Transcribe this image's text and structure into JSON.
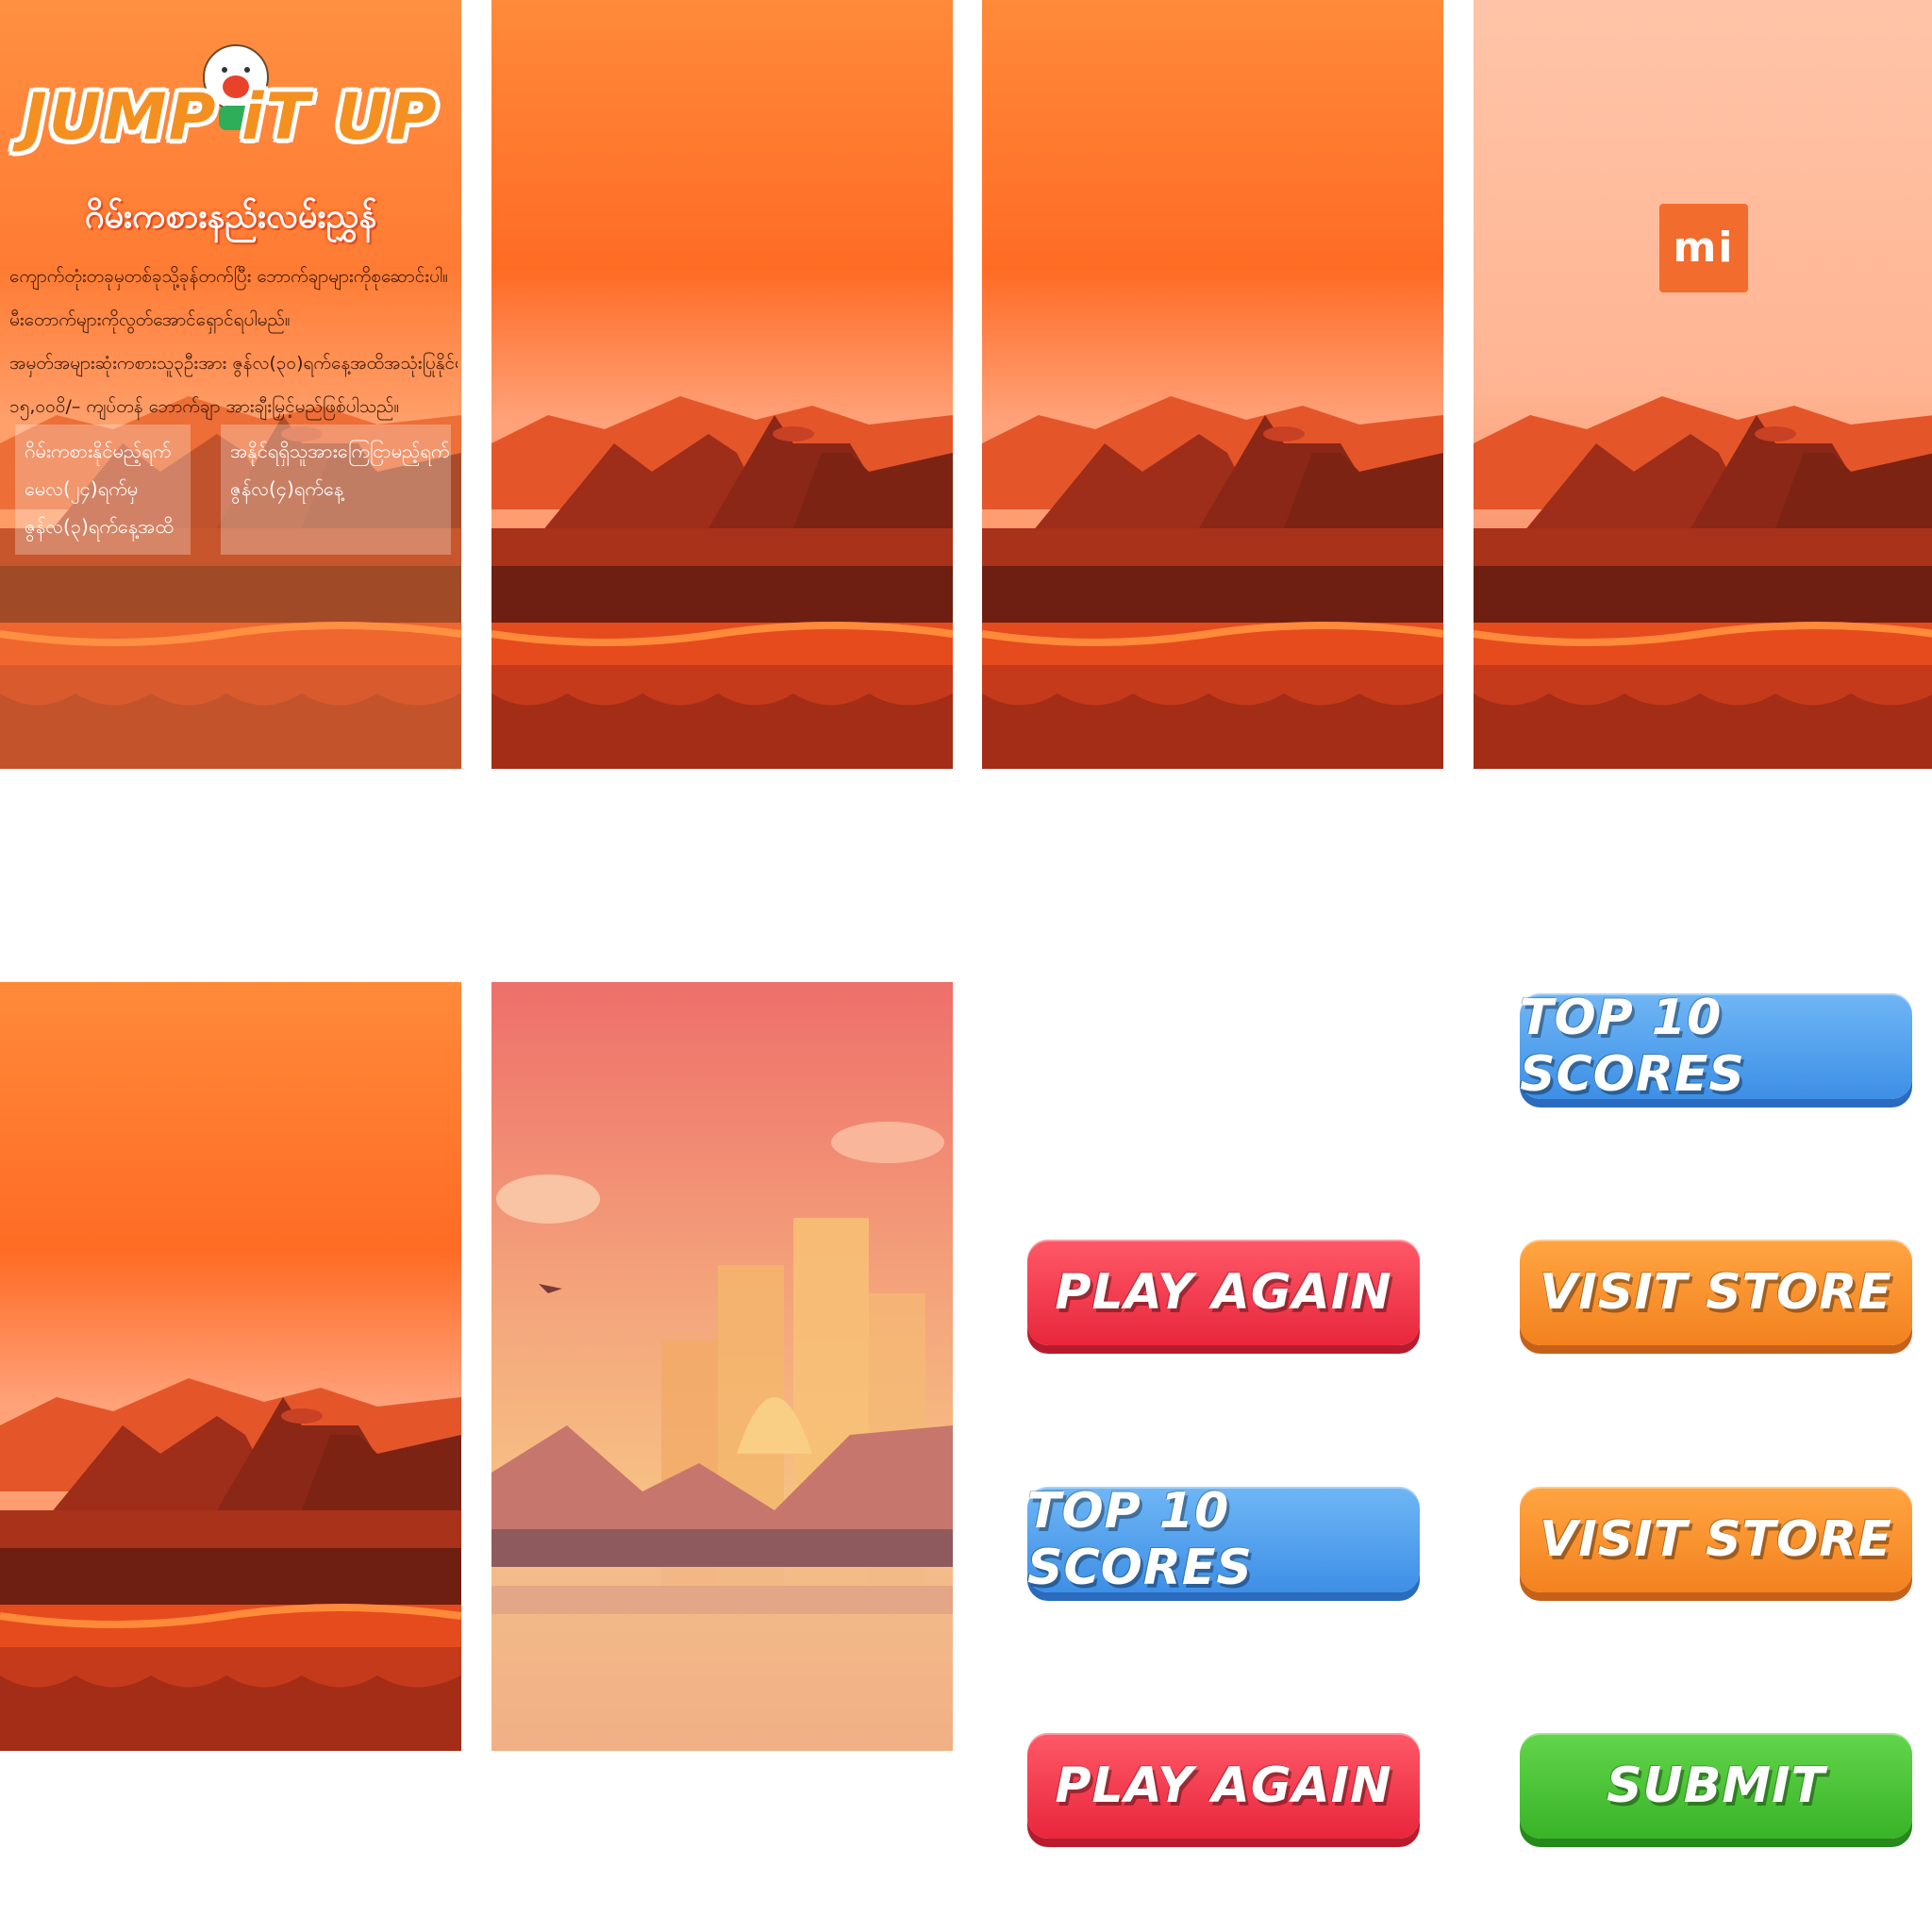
{
  "title_panel": {
    "logo": "JUMP iT UP",
    "subtitle": "ဂိမ်းကစားနည်းလမ်းညွှန်",
    "rules": [
      "ကျောက်တုံးတခုမှတစ်ခုသို့ခုန်တက်ပြီး ဘောက်ချာများကိုစုဆောင်းပါ။",
      "မီးတောက်များကိုလွတ်အောင်ရှောင်ရပါမည်။",
      "အမှတ်အများဆုံးကစားသူ၃ဦးအား ဇွန်လ(၃၀)ရက်နေ့အထိအသုံးပြုနိုင်မည့်",
      "၁၅,၀၀၀ိ/– ကျပ်တန် ဘောက်ချာ အားချီးမြှင့်မည်ဖြစ်ပါသည်။"
    ],
    "game_period": [
      "ဂိမ်းကစားနိုင်မည့်ရက်",
      "မေလ(၂၄)ရက်မှ",
      "ဇွန်လ(၃)ရက်နေ့အထိ"
    ],
    "announce_date": [
      "အနိုင်ရရှိသူအားကြေငြာမည့်ရက်",
      "ဇွန်လ(၄)ရက်နေ့"
    ]
  },
  "mi_logo": "mi",
  "buttons": {
    "top10_a": "TOP 10 SCORES",
    "play_again_a": "PLAY AGAIN",
    "visit_store_a": "VISIT STORE",
    "top10_b": "TOP 10 SCORES",
    "visit_store_b": "VISIT STORE",
    "play_again_b": "PLAY AGAIN",
    "submit": "SUBMIT"
  },
  "colors": {
    "blue": "#4a9ced",
    "red": "#f23a4d",
    "orange": "#f79330",
    "green": "#45c234",
    "sky_orange": "#ff7a2a"
  }
}
